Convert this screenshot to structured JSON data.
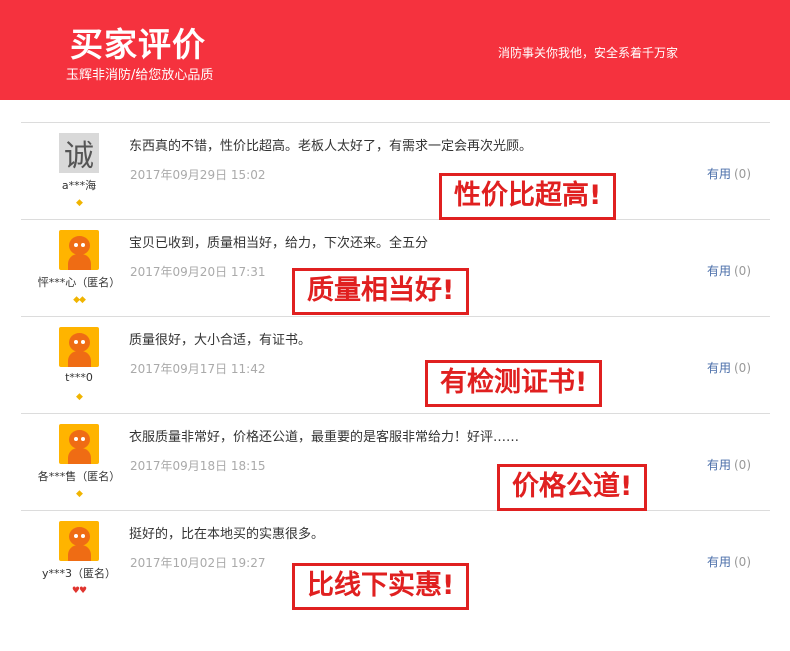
{
  "header": {
    "title": "买家评价",
    "subtitle": "玉辉非消防/给您放心品质",
    "slogan": "消防事关你我他，安全系着千万家"
  },
  "reviews": [
    {
      "avatar": "cheng-avatar",
      "avatar_text": "诚",
      "username": "a***海",
      "badge": "◆",
      "content": "东西真的不错，性价比超高。老板人太好了，有需求一定会再次光顾。",
      "date": "2017年09月29日 15:02",
      "useful_label": "有用",
      "useful_count": "(0)",
      "stamp": "性价比超高!"
    },
    {
      "avatar": "taobao-avatar",
      "username": "怦***心（匿名）",
      "badge": "◆◆",
      "content": "宝贝已收到，质量相当好，给力，下次还来。全五分",
      "date": "2017年09月20日 17:31",
      "useful_label": "有用",
      "useful_count": "(0)",
      "stamp": "质量相当好!"
    },
    {
      "avatar": "taobao-avatar",
      "username": "t***0",
      "badge": "◆",
      "content": "质量很好，大小合适，有证书。",
      "date": "2017年09月17日 11:42",
      "useful_label": "有用",
      "useful_count": "(0)",
      "stamp": "有检测证书!"
    },
    {
      "avatar": "taobao-avatar",
      "username": "各***售（匿名）",
      "badge": "◆",
      "content": "衣服质量非常好，价格还公道，最重要的是客服非常给力！好评……",
      "date": "2017年09月18日 18:15",
      "useful_label": "有用",
      "useful_count": "(0)",
      "stamp": "价格公道!"
    },
    {
      "avatar": "taobao-avatar",
      "username": "y***3（匿名）",
      "badge": "♥♥",
      "content": "挺好的，比在本地买的实惠很多。",
      "date": "2017年10月02日 19:27",
      "useful_label": "有用",
      "useful_count": "(0)",
      "stamp": "比线下实惠!"
    }
  ]
}
